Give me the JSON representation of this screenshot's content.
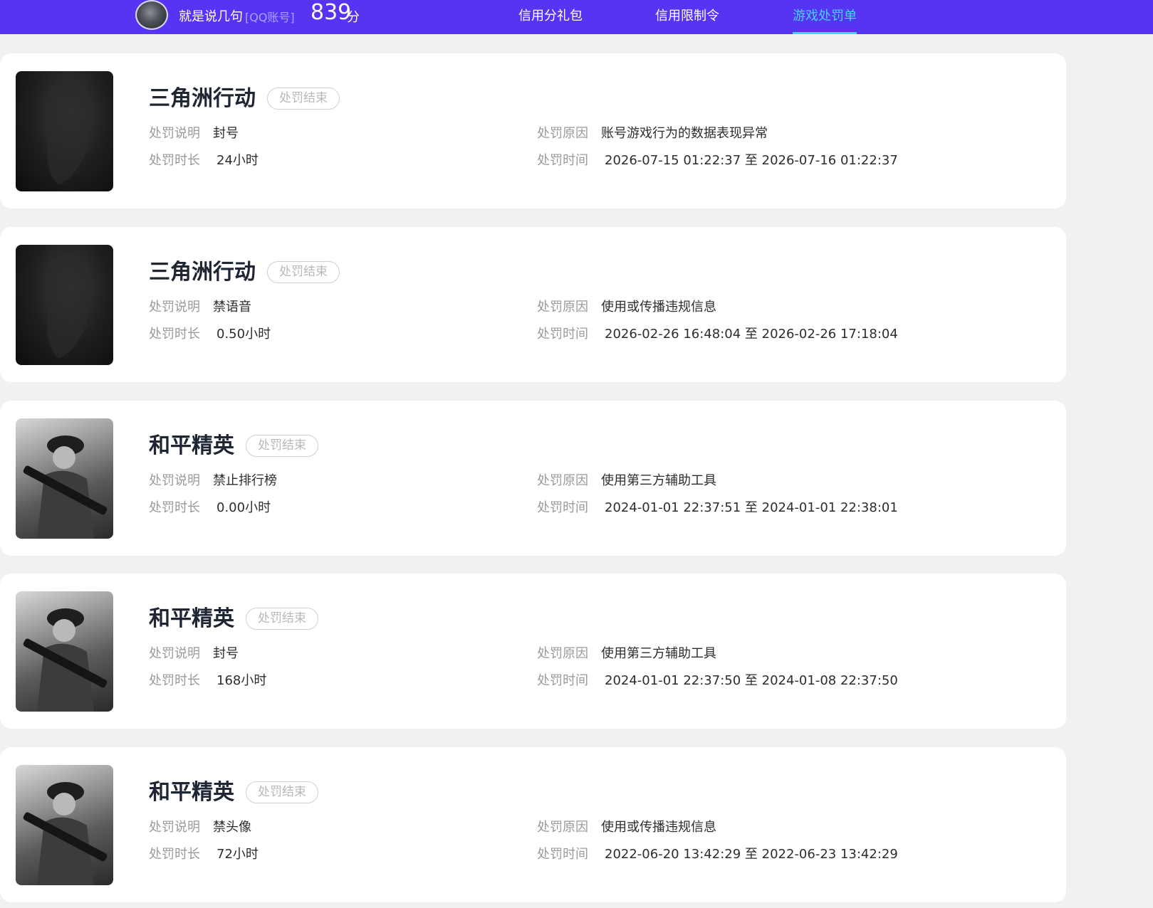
{
  "header": {
    "username": "就是说几句",
    "account_type": "[QQ账号]",
    "score": "839",
    "score_unit": "分",
    "tabs": [
      {
        "label": "信用分礼包",
        "active": false
      },
      {
        "label": "信用限制令",
        "active": false
      },
      {
        "label": "游戏处罚单",
        "active": true
      }
    ],
    "colors": {
      "bar": "#5634f2",
      "active_tab": "#41d6ff"
    }
  },
  "labels": {
    "description": "处罚说明",
    "duration": "处罚时长",
    "reason": "处罚原因",
    "time": "处罚时间"
  },
  "records": [
    {
      "game": "三角洲行动",
      "status": "处罚结束",
      "description": "封号",
      "duration": "24小时",
      "reason": "账号游戏行为的数据表现异常",
      "time": "2026-07-15 01:22:37 至 2026-07-16 01:22:37"
    },
    {
      "game": "三角洲行动",
      "status": "处罚结束",
      "description": "禁语音",
      "duration": "0.50小时",
      "reason": "使用或传播违规信息",
      "time": "2026-02-26 16:48:04 至 2026-02-26 17:18:04"
    },
    {
      "game": "和平精英",
      "status": "处罚结束",
      "description": "禁止排行榜",
      "duration": "0.00小时",
      "reason": "使用第三方辅助工具",
      "time": "2024-01-01 22:37:51 至 2024-01-01 22:38:01"
    },
    {
      "game": "和平精英",
      "status": "处罚结束",
      "description": "封号",
      "duration": "168小时",
      "reason": "使用第三方辅助工具",
      "time": "2024-01-01 22:37:50 至 2024-01-08 22:37:50"
    },
    {
      "game": "和平精英",
      "status": "处罚结束",
      "description": "禁头像",
      "duration": "72小时",
      "reason": "使用或传播违规信息",
      "time": "2022-06-20 13:42:29 至 2022-06-23 13:42:29"
    }
  ]
}
